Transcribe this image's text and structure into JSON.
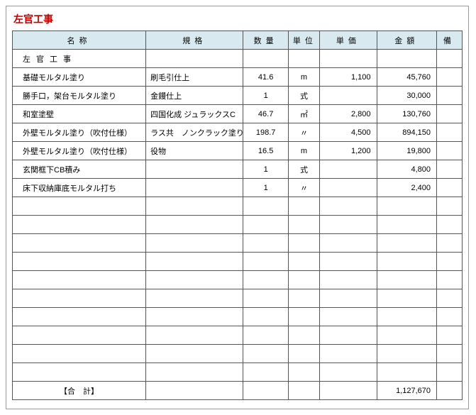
{
  "title": "左官工事",
  "headers": {
    "name": "名称",
    "spec": "規格",
    "qty": "数量",
    "unit": "単位",
    "uprice": "単価",
    "amount": "金額",
    "note": "備"
  },
  "section_heading": "左官工事",
  "rows": [
    {
      "name": "基礎モルタル塗り",
      "spec": "刷毛引仕上",
      "qty": "41.6",
      "unit": "m",
      "uprice": "1,100",
      "amount": "45,760"
    },
    {
      "name": "勝手口，架台モルタル塗り",
      "spec": "金鏝仕上",
      "qty": "1",
      "unit": "式",
      "uprice": "",
      "amount": "30,000"
    },
    {
      "name": "和室塗壁",
      "spec": "四国化成 ジュラックスC",
      "qty": "46.7",
      "unit": "㎡",
      "uprice": "2,800",
      "amount": "130,760"
    },
    {
      "name": "外壁モルタル塗り（吹付仕様）",
      "spec": "ラス共　ノンクラック塗り",
      "qty": "198.7",
      "unit": "〃",
      "uprice": "4,500",
      "amount": "894,150"
    },
    {
      "name": "外壁モルタル塗り（吹付仕様）",
      "spec": "役物",
      "qty": "16.5",
      "unit": "m",
      "uprice": "1,200",
      "amount": "19,800"
    },
    {
      "name": "玄関框下CB積み",
      "spec": "",
      "qty": "1",
      "unit": "式",
      "uprice": "",
      "amount": "4,800"
    },
    {
      "name": "床下収納庫底モルタル打ち",
      "spec": "",
      "qty": "1",
      "unit": "〃",
      "uprice": "",
      "amount": "2,400"
    }
  ],
  "empty_rows": 10,
  "total": {
    "label": "【合　計】",
    "amount": "1,127,670"
  }
}
